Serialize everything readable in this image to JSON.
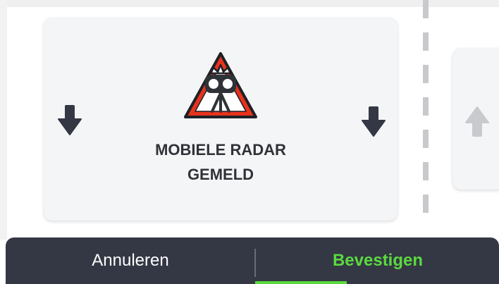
{
  "alert_card": {
    "title_line1": "MOBIELE RADAR",
    "title_line2": "GEMELD",
    "icon": "mobile-radar-warning-icon",
    "left_icon": "arrow-down-icon",
    "right_icon": "arrow-down-icon"
  },
  "next_card": {
    "icon": "arrow-up-icon"
  },
  "actions": {
    "cancel_label": "Annuleren",
    "confirm_label": "Bevestigen"
  },
  "colors": {
    "accent_green": "#5ad93e",
    "action_bar": "#343744",
    "warning_red": "#e8321c",
    "text_dark": "#2f3237"
  }
}
